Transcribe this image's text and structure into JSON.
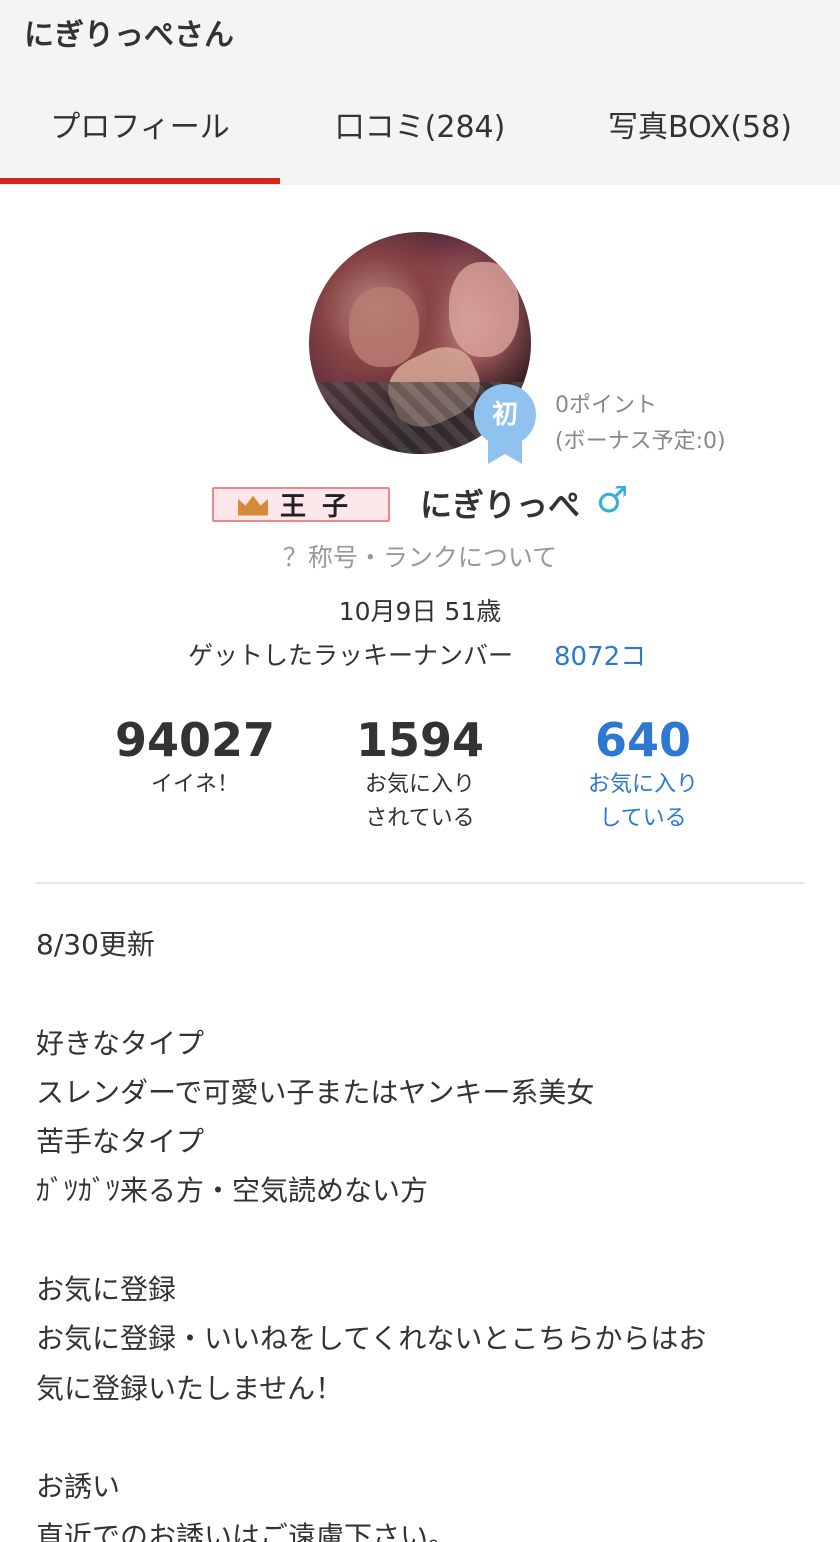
{
  "header": {
    "title": "にぎりっぺさん"
  },
  "tabs": [
    {
      "label": "プロフィール",
      "active": true
    },
    {
      "label": "口コミ(284)",
      "active": false
    },
    {
      "label": "写真BOX(58)",
      "active": false
    }
  ],
  "profile": {
    "first_badge": "初",
    "points": "0ポイント",
    "bonus": "(ボーナス予定:0)",
    "rank_label": "王子",
    "username": "にぎりっぺ",
    "gender_icon": "♂",
    "rank_help": "？称号・ランクについて",
    "birthday_age": "10月9日 51歳",
    "lucky_label": "ゲットしたラッキーナンバー",
    "lucky_value": "8072コ"
  },
  "stats": [
    {
      "value": "94027",
      "label_line1": "イイネ！",
      "label_line2": ""
    },
    {
      "value": "1594",
      "label_line1": "お気に入り",
      "label_line2": "されている"
    },
    {
      "value": "640",
      "label_line1": "お気に入り",
      "label_line2": "している"
    }
  ],
  "bio": {
    "text": "8/30更新\n\n好きなタイプ\nスレンダーで可愛い子またはヤンキー系美女\n苦手なタイプ\nｶﾞﾂｶﾞﾂ来る方・空気読めない方\n\nお気に登録\nお気に登録・いいねをしてくれないとこちらからはお\n気に登録いたしません！\n\nお誘い\n直近でのお誘いはご遠慮下さい。"
  },
  "colors": {
    "accent_red": "#d9251d",
    "link_blue": "#2d79d1",
    "badge_blue": "#90c2f0",
    "male_blue": "#38aee0"
  }
}
